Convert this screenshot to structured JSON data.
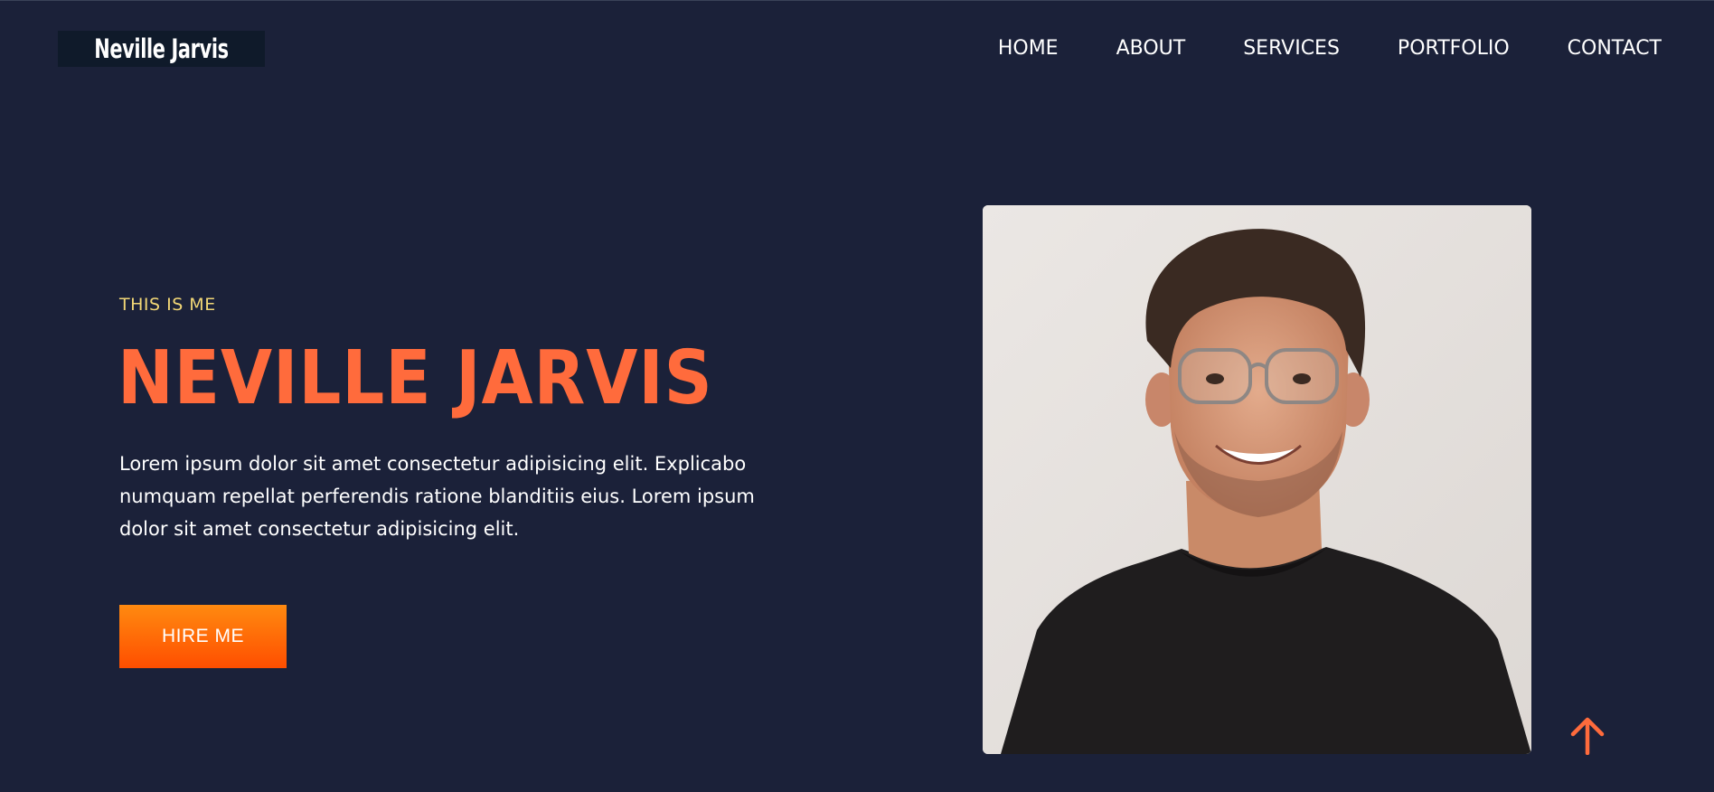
{
  "header": {
    "logo": "Neville Jarvis",
    "nav": [
      {
        "label": "HOME"
      },
      {
        "label": "ABOUT"
      },
      {
        "label": "SERVICES"
      },
      {
        "label": "PORTFOLIO"
      },
      {
        "label": "CONTACT"
      }
    ]
  },
  "hero": {
    "eyebrow": "THIS IS ME",
    "name": "NEVILLE JARVIS",
    "description": "Lorem ipsum dolor sit amet consectetur adipisicing elit. Explicabo numquam repellat perferendis ratione blanditiis eius. Lorem ipsum dolor sit amet consectetur adipisicing elit.",
    "button_label": "HIRE ME",
    "photo_alt": "portrait-photo"
  },
  "icons": {
    "scroll_top": "arrow-up-icon"
  },
  "colors": {
    "background": "#1b2139",
    "accent": "#ff6b3c",
    "eyebrow": "#f2d776",
    "button_top": "#ff8a10",
    "button_bottom": "#ff4e00"
  }
}
